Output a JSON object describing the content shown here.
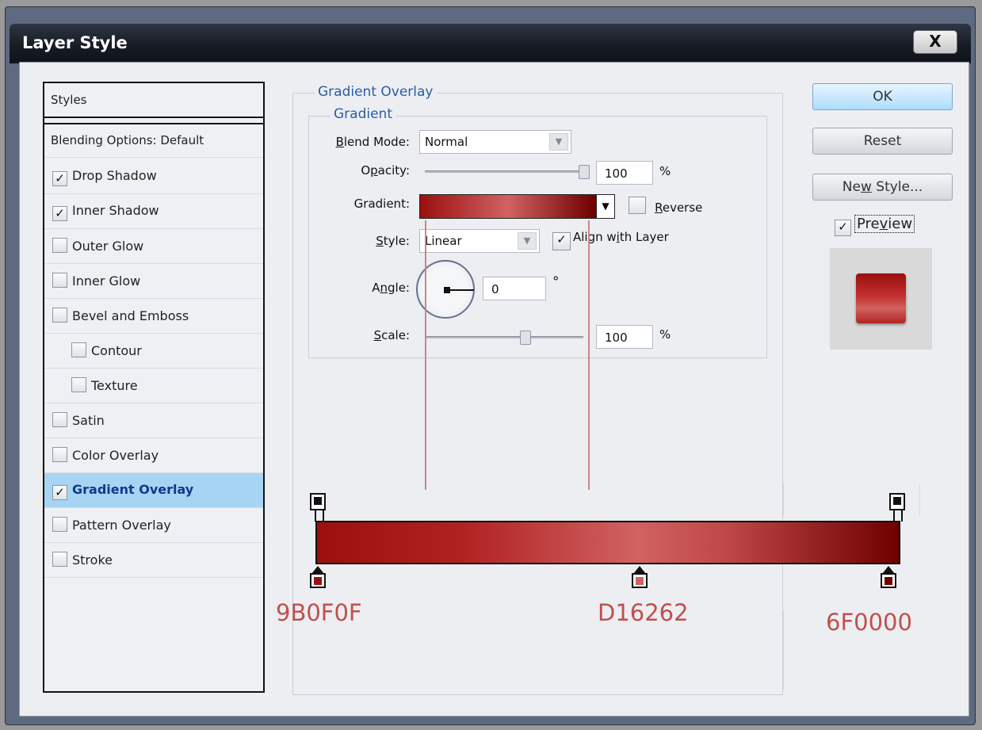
{
  "window": {
    "title": "Layer Style",
    "close_label": "X"
  },
  "styles_list": {
    "header": "Styles",
    "blending": "Blending Options: Default",
    "items": [
      {
        "label": "Drop Shadow",
        "checked": true
      },
      {
        "label": "Inner Shadow",
        "checked": true
      },
      {
        "label": "Outer Glow",
        "checked": false
      },
      {
        "label": "Inner Glow",
        "checked": false
      },
      {
        "label": "Bevel and Emboss",
        "checked": false
      },
      {
        "label": "Contour",
        "checked": false
      },
      {
        "label": "Texture",
        "checked": false
      },
      {
        "label": "Satin",
        "checked": false
      },
      {
        "label": "Color Overlay",
        "checked": false
      },
      {
        "label": "Gradient Overlay",
        "checked": true,
        "active": true
      },
      {
        "label": "Pattern Overlay",
        "checked": false
      },
      {
        "label": "Stroke",
        "checked": false
      }
    ]
  },
  "panel": {
    "legend_outer": "Gradient Overlay",
    "legend_inner": "Gradient",
    "blend_mode": {
      "label_pre": "",
      "label_u": "B",
      "label_post": "lend Mode:",
      "value": "Normal"
    },
    "opacity": {
      "label_pre": "O",
      "label_u": "p",
      "label_post": "acity:",
      "value": "100",
      "unit": "%",
      "level": 1.0
    },
    "gradient": {
      "label": "Gradient:",
      "reverse_u": "R",
      "reverse_rest": "everse",
      "reverse_checked": false
    },
    "style": {
      "label_u": "S",
      "label_post": "tyle:",
      "value": "Linear",
      "align_pre": "Align w",
      "align_u": "i",
      "align_post": "th Layer",
      "align_checked": true
    },
    "angle": {
      "label_pre": "A",
      "label_u": "n",
      "label_post": "gle:",
      "value": "0",
      "unit": "°"
    },
    "scale": {
      "label_u": "S",
      "label_post": "cale:",
      "value": "100",
      "unit": "%",
      "level": 0.6
    }
  },
  "gradient_editor": {
    "stops": [
      {
        "hex": "9B0F0F",
        "color": "#9b0f0f"
      },
      {
        "hex": "D16262",
        "color": "#d16262"
      },
      {
        "hex": "6F0000",
        "color": "#6f0000"
      }
    ]
  },
  "buttons": {
    "ok": "OK",
    "reset": "Reset",
    "new_style_pre": "Ne",
    "new_style_u": "w",
    "new_style_post": " Style...",
    "preview_pre": "Pre",
    "preview_u": "v",
    "preview_post": "iew",
    "preview_checked": true
  },
  "colors": {
    "accent": "#2b5da3",
    "hex_label": "#c0504d",
    "active_row": "#a8d4f3"
  }
}
